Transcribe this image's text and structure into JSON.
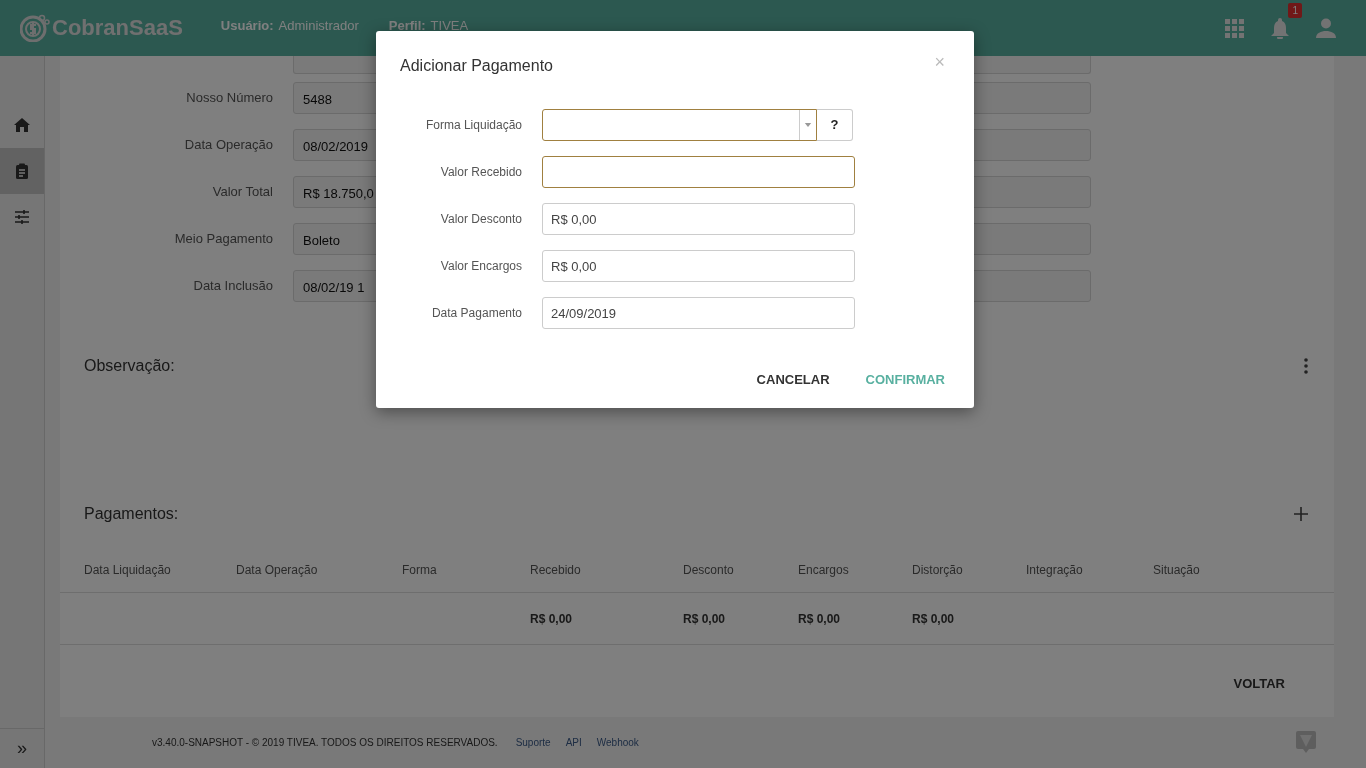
{
  "header": {
    "logo": "CobranSaaS",
    "user_label": "Usuário:",
    "user": "Administrador",
    "profile_label": "Perfil:",
    "profile": "TIVEA",
    "notification_count": "1"
  },
  "sidebar": {
    "items": [
      {
        "kind": "home",
        "selected": false
      },
      {
        "kind": "clipboard",
        "selected": true
      },
      {
        "kind": "sliders",
        "selected": false
      }
    ],
    "expand": "»"
  },
  "details": {
    "fields": [
      {
        "label": "Nosso Número",
        "value": "5488"
      },
      {
        "label": "Data Operação",
        "value": "08/02/2019"
      },
      {
        "label": "Valor Total",
        "value": "R$ 18.750,0"
      },
      {
        "label": "Meio Pagamento",
        "value": "Boleto"
      },
      {
        "label": "Data Inclusão",
        "value": "08/02/19 1"
      }
    ]
  },
  "observation": {
    "title": "Observação:"
  },
  "payments": {
    "title": "Pagamentos:",
    "columns": [
      "Data Liquidação",
      "Data Operação",
      "Forma",
      "Recebido",
      "Desconto",
      "Encargos",
      "Distorção",
      "Integração",
      "Situação"
    ],
    "totals": {
      "received": "R$ 0,00",
      "discount": "R$ 0,00",
      "charges": "R$ 0,00",
      "distortion": "R$ 0,00"
    }
  },
  "back_button": "VOLTAR",
  "footer": {
    "copyright": "v3.40.0-SNAPSHOT - © 2019 TIVEA. TODOS OS DIREITOS RESERVADOS.",
    "links": [
      "Suporte",
      "API",
      "Webhook"
    ]
  },
  "dialog": {
    "title": "Adicionar Pagamento",
    "close": "×",
    "help": "?",
    "fields": [
      {
        "label": "Forma Liquidação",
        "kind": "select",
        "highlighted": true
      },
      {
        "label": "Valor Recebido",
        "kind": "text",
        "highlighted": true
      },
      {
        "label": "Valor Desconto",
        "kind": "text",
        "value": "R$ 0,00",
        "highlighted": false
      },
      {
        "label": "Valor Encargos",
        "kind": "text",
        "value": "R$ 0,00",
        "highlighted": false
      },
      {
        "label": "Data Pagamento",
        "kind": "text",
        "value": "24/09/2019",
        "highlighted": false
      }
    ],
    "buttons": [
      {
        "label": "CANCELAR",
        "kind": "cancel"
      },
      {
        "label": "CONFIRMAR",
        "kind": "confirm"
      }
    ]
  }
}
